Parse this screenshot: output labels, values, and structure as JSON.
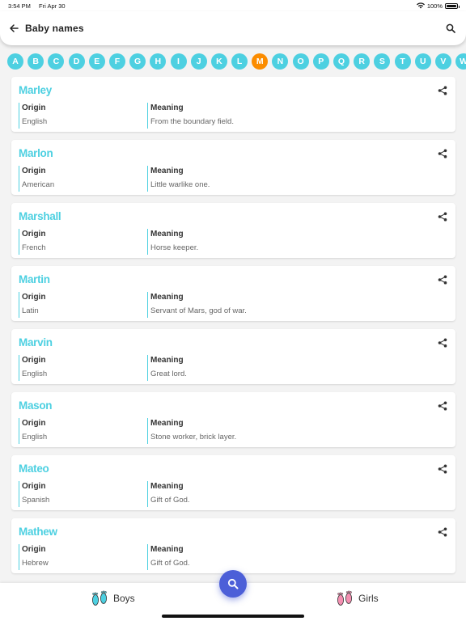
{
  "status": {
    "time": "3:54 PM",
    "date": "Fri Apr 30",
    "battery": "100%",
    "battery_level": 1.0
  },
  "header": {
    "title": "Baby names"
  },
  "alphabet": {
    "letters": [
      "A",
      "B",
      "C",
      "D",
      "E",
      "F",
      "G",
      "H",
      "I",
      "J",
      "K",
      "L",
      "M",
      "N",
      "O",
      "P",
      "Q",
      "R",
      "S",
      "T",
      "U",
      "V",
      "W"
    ],
    "active": "M"
  },
  "labels": {
    "origin": "Origin",
    "meaning": "Meaning"
  },
  "names": [
    {
      "name": "Marley",
      "origin": "English",
      "meaning": "From the boundary field."
    },
    {
      "name": "Marlon",
      "origin": "American",
      "meaning": "Little warlike one."
    },
    {
      "name": "Marshall",
      "origin": "French",
      "meaning": "Horse keeper."
    },
    {
      "name": "Martin",
      "origin": "Latin",
      "meaning": "Servant of Mars, god of war."
    },
    {
      "name": "Marvin",
      "origin": "English",
      "meaning": "Great lord."
    },
    {
      "name": "Mason",
      "origin": "English",
      "meaning": "Stone worker, brick layer."
    },
    {
      "name": "Mateo",
      "origin": "Spanish",
      "meaning": "Gift of God."
    },
    {
      "name": "Mathew",
      "origin": "Hebrew",
      "meaning": "Gift of God."
    }
  ],
  "bottom_nav": {
    "boys": "Boys",
    "girls": "Girls"
  },
  "colors": {
    "accent": "#4dd0e1",
    "active_letter": "#fb8c00",
    "fab": "#4c5fd8",
    "boys_feet": "#4dd0e1",
    "girls_feet": "#f48fb1"
  },
  "icons": {
    "back": "arrow-left-icon",
    "search": "search-icon",
    "share": "share-icon",
    "boys": "baby-feet-blue-icon",
    "girls": "baby-feet-pink-icon"
  }
}
